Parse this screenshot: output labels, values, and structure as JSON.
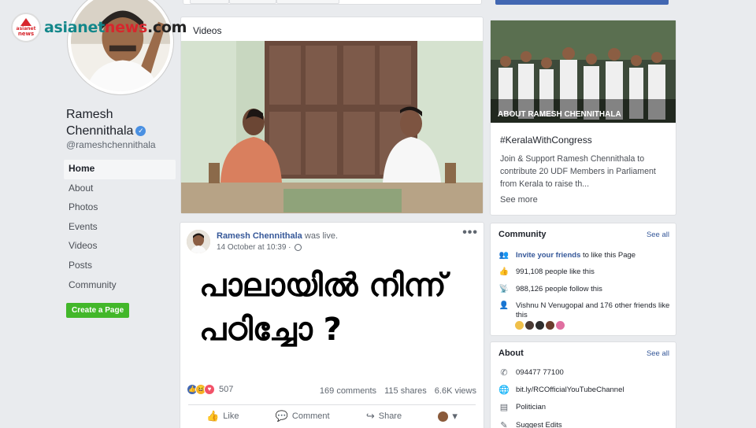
{
  "watermark": {
    "badge_line1": "asianet",
    "badge_line2": "news",
    "part1": "asianet",
    "part2": "news",
    "part3": ".com"
  },
  "profile": {
    "name": "Ramesh Chennithala",
    "handle": "@rameshchennithala",
    "verified_glyph": "✓"
  },
  "nav": {
    "items": [
      "Home",
      "About",
      "Photos",
      "Events",
      "Videos",
      "Posts",
      "Community"
    ],
    "active": "Home"
  },
  "create_page_label": "Create a Page",
  "videos_card": {
    "label": "Videos"
  },
  "post": {
    "author": "Ramesh Chennithala",
    "status": "was live.",
    "time": "14 October at 10:39 · ",
    "more_glyph": "•••",
    "text_line1": "പാലായിൽ നിന്ന്",
    "text_line2": "പഠിച്ചോ ?",
    "reaction_count": "507",
    "comments": "169 comments",
    "shares": "115 shares",
    "views": "6.6K views",
    "actions": {
      "like": "Like",
      "comment": "Comment",
      "share": "Share"
    }
  },
  "about_hero": {
    "caption": "ABOUT RAMESH CHENNITHALA",
    "hashtag": "#KeralaWithCongress",
    "description": "Join & Support Ramesh Chennithala to contribute 20 UDF Members in Parliament from Kerala to raise th...",
    "see_more": "See more"
  },
  "community": {
    "title": "Community",
    "see_all": "See all",
    "invite_link": "Invite your friends",
    "invite_rest": " to like this Page",
    "likes": "991,108 people like this",
    "follows": "988,126 people follow this",
    "friends": "Vishnu N Venugopal and 176 other friends like this"
  },
  "about": {
    "title": "About",
    "see_all": "See all",
    "phone": "094477 77100",
    "website": "bit.ly/RCOfficialYouTubeChannel",
    "category": "Politician",
    "suggest": "Suggest Edits"
  },
  "colors": {
    "background": "#e9ebee",
    "link": "#365899",
    "create_page": "#42b72a",
    "verified": "#4a90e2"
  }
}
